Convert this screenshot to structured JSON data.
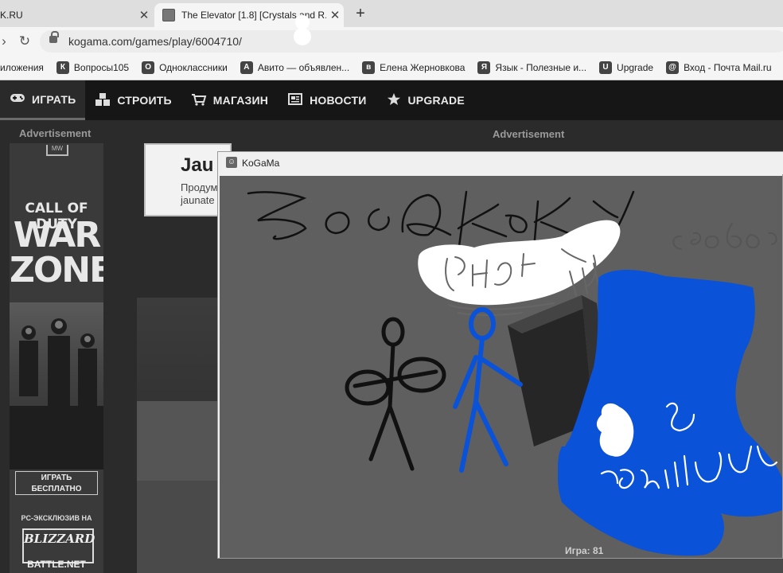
{
  "browser": {
    "tabs": [
      {
        "label": "K.RU",
        "close": "✕"
      },
      {
        "label": "The Elevator [1.8] [Crystals and R...",
        "close": "✕"
      }
    ],
    "new_tab": "+",
    "url": "kogama.com/games/play/6004710/",
    "bookmarks": [
      {
        "label": "иложения"
      },
      {
        "label": "Вопросы105",
        "icon": "К"
      },
      {
        "label": "Одноклассники",
        "icon": "О"
      },
      {
        "label": "Авито — объявлен...",
        "icon": "А"
      },
      {
        "label": "Елена Жерновкова",
        "icon": "в"
      },
      {
        "label": "Язык - Полезные и...",
        "icon": "Я"
      },
      {
        "label": "Upgrade",
        "icon": "U"
      },
      {
        "label": "Вход - Почта Mail.ru",
        "icon": "@"
      }
    ]
  },
  "site_nav": [
    {
      "label": "ИГРАТЬ",
      "icon": "gamepad-icon"
    },
    {
      "label": "СТРОИТЬ",
      "icon": "cubes-icon"
    },
    {
      "label": "МАГАЗИН",
      "icon": "cart-icon"
    },
    {
      "label": "НОВОСТИ",
      "icon": "news-icon"
    },
    {
      "label": "UPGRADE",
      "icon": "star-icon"
    }
  ],
  "ads": {
    "left_label": "Advertisement",
    "center_label": "Advertisement",
    "side": {
      "top": "MW",
      "brand": "CALL OF DUTY",
      "title_1": "WAR",
      "title_2": "ZONE",
      "cta": "ИГРАТЬ БЕСПЛАТНО",
      "exclusive": "PC-ЭКСКЛЮЗИВ НА",
      "platform": "BLIZZARD",
      "platform_sub": "BATTLE.NET"
    }
  },
  "game_card": {
    "title": "Jau",
    "desc_1": "Продум",
    "desc_2": "jaunate"
  },
  "kogama_window": {
    "title": "KoGaMa",
    "fps": "Игра: 81"
  },
  "colors": {
    "scribble_blue": "#0a52d8",
    "scribble_black": "#111111",
    "cloud": "#ffffff"
  }
}
